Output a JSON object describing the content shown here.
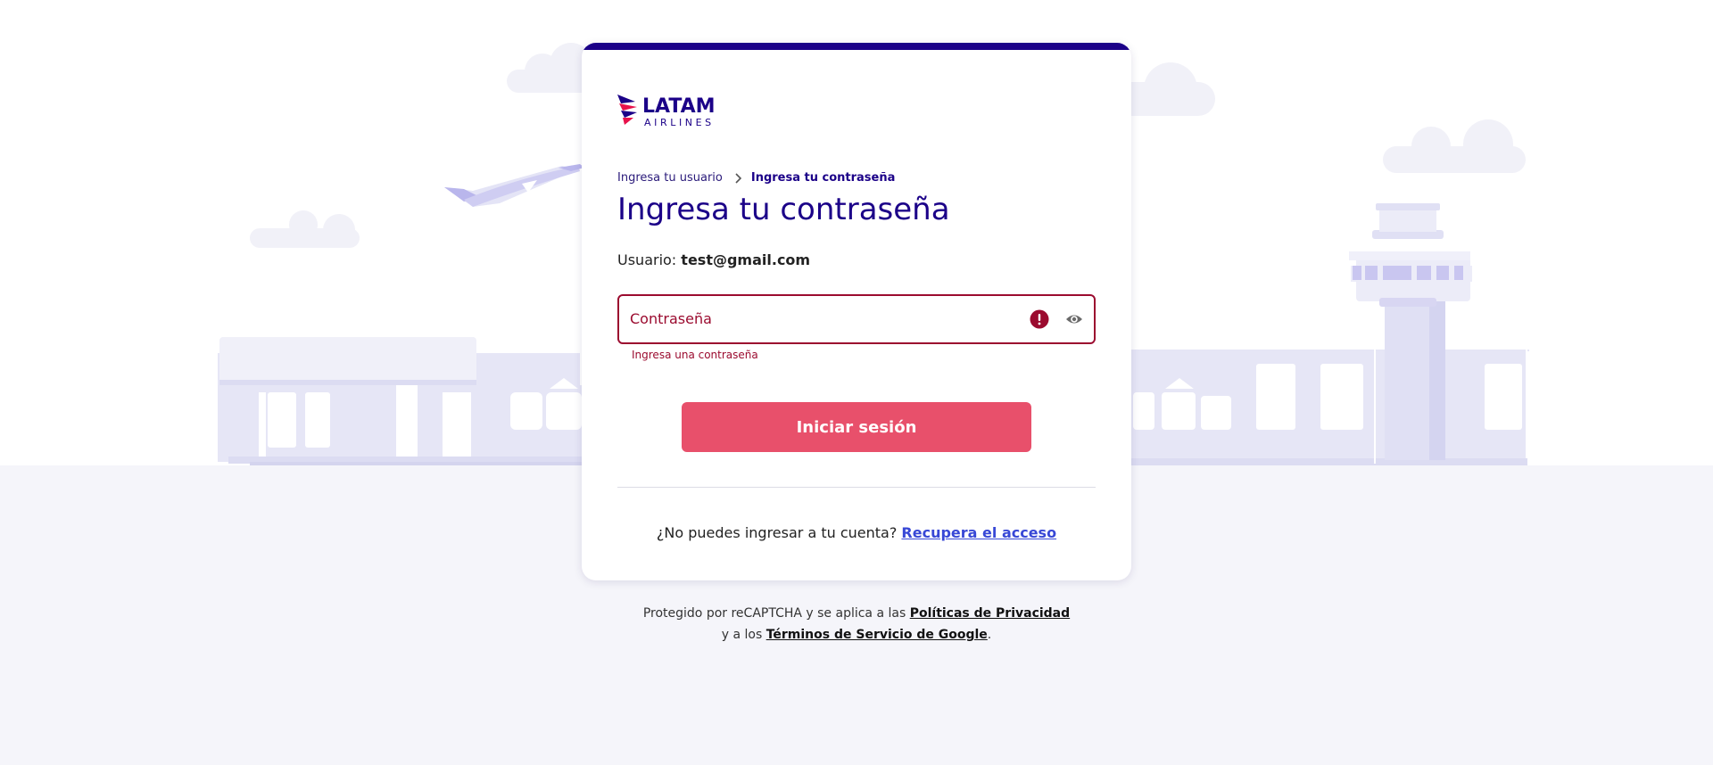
{
  "brand": {
    "name": "LATAM",
    "subname": "AIRLINES",
    "primary_color": "#1b0088",
    "accent_color": "#e8506b",
    "error_color": "#9b0b2f"
  },
  "breadcrumb": {
    "step1": "Ingresa tu usuario",
    "step2": "Ingresa tu contraseña"
  },
  "page": {
    "title": "Ingresa tu contraseña"
  },
  "user": {
    "label": "Usuario:",
    "value": "test@gmail.com"
  },
  "password": {
    "label": "Contraseña",
    "error": "Ingresa una contraseña",
    "state": "error"
  },
  "actions": {
    "submit_label": "Iniciar sesión"
  },
  "recover": {
    "question": "¿No puedes ingresar a tu cuenta?",
    "link": "Recupera el acceso"
  },
  "recaptcha": {
    "prefix": "Protegido por reCAPTCHA y se aplica a las",
    "privacy_link": "Políticas de Privacidad",
    "middle": "y a los",
    "terms_link": "Términos de Servicio de Google",
    "suffix": "."
  },
  "icons": {
    "breadcrumb_separator": "chevron-right-icon",
    "error": "error-icon",
    "toggle_visibility": "eye-icon"
  }
}
